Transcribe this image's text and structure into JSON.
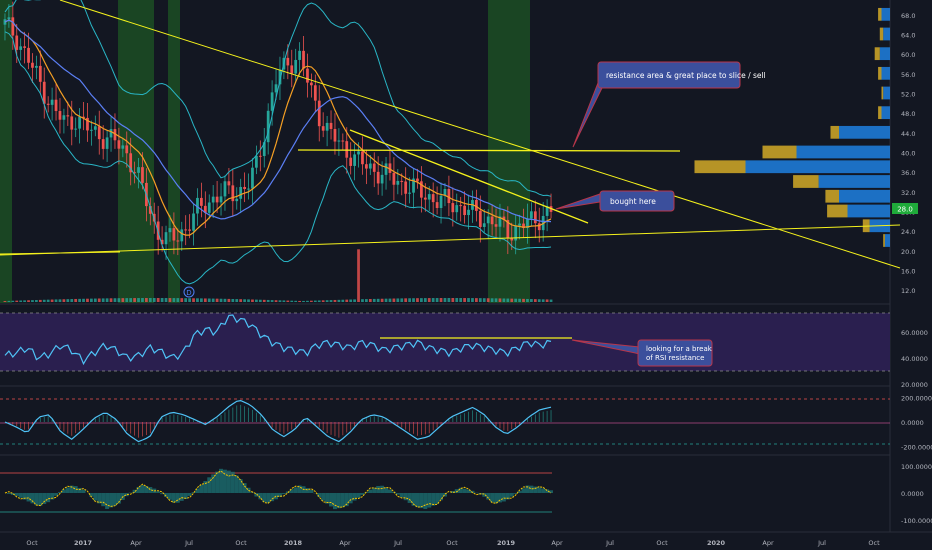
{
  "colors": {
    "background": "#131722",
    "up": "#26a69a",
    "down": "#ef5350",
    "yellow": "#f5f21c",
    "orange": "#f59f24",
    "blue_ma": "#5b7ff5",
    "bollinger": "#29b6c6",
    "rsi": "#4fc3f7",
    "rsi_band": "#2a1f4f",
    "green_zone": "#1e5a24",
    "callout_fill": "#3b4f9c",
    "callout_border": "#b8364a",
    "vp_blue": "#1e7ad6",
    "vp_gold": "#c9a227",
    "price_tag": "#1faa3a"
  },
  "chart_data": [
    {
      "type": "candlestick",
      "name": "price-panel",
      "ylim": [
        10,
        70
      ],
      "yticks": [
        "68.0",
        "64.0",
        "60.0",
        "56.0",
        "52.0",
        "48.0",
        "44.0",
        "40.0",
        "36.0",
        "32.0",
        "28.0",
        "24.0",
        "20.0",
        "16.0",
        "12.0"
      ],
      "last_price_label": "28.0",
      "close_series": [
        66,
        64,
        60,
        56,
        52,
        48,
        46,
        47,
        45,
        44,
        43,
        42,
        40,
        36,
        30,
        24,
        22,
        23,
        25,
        28,
        30,
        31,
        32,
        32,
        33,
        38,
        48,
        56,
        58,
        60,
        54,
        48,
        44,
        42,
        40,
        38,
        37,
        36,
        35,
        34,
        33,
        32,
        31,
        30,
        30,
        29,
        28,
        27,
        26,
        25,
        24,
        25,
        26,
        27,
        28
      ],
      "annotations": [
        "resistance area & great place to slice / sell",
        "bought here"
      ],
      "marker": "D"
    },
    {
      "type": "line",
      "name": "rsi-panel",
      "yticks": [
        "60.0000",
        "40.0000",
        "20.0000"
      ],
      "ylim": [
        20,
        80
      ],
      "values": [
        42,
        44,
        48,
        40,
        43,
        50,
        46,
        38,
        44,
        50,
        46,
        40,
        42,
        48,
        45,
        40,
        44,
        58,
        62,
        60,
        72,
        70,
        66,
        58,
        52,
        48,
        46,
        44,
        50,
        52,
        50,
        48,
        52,
        50,
        46,
        48,
        50,
        52,
        48,
        46,
        44,
        48,
        50,
        48,
        46,
        44,
        48,
        52,
        50,
        52
      ],
      "annotation": "looking for a break\nof RSI resistance"
    },
    {
      "type": "line",
      "name": "cci-panel",
      "yticks": [
        "200.0000",
        "0.0000",
        "-200.0000"
      ],
      "ylim": [
        -260,
        260
      ],
      "values": [
        0,
        -40,
        -90,
        40,
        60,
        -80,
        -140,
        -60,
        30,
        80,
        20,
        -100,
        -160,
        -120,
        40,
        80,
        60,
        20,
        -20,
        40,
        120,
        180,
        140,
        60,
        -60,
        -120,
        -60,
        40,
        -40,
        -120,
        -160,
        -80,
        20,
        60,
        40,
        -20,
        -80,
        -140,
        -120,
        -40,
        40,
        80,
        120,
        60,
        -40,
        -100,
        -40,
        40,
        100,
        120
      ]
    },
    {
      "type": "line",
      "name": "osc-panel",
      "yticks": [
        "100.0000",
        "0.0000",
        "-100.0000"
      ],
      "ylim": [
        -130,
        130
      ],
      "values": [
        0,
        -10,
        -30,
        -50,
        -30,
        10,
        30,
        10,
        -30,
        -60,
        -40,
        0,
        30,
        20,
        -10,
        -40,
        -20,
        20,
        60,
        90,
        80,
        40,
        -10,
        -40,
        -20,
        10,
        30,
        10,
        -30,
        -60,
        -50,
        -20,
        10,
        30,
        10,
        -20,
        -50,
        -60,
        -40,
        0,
        20,
        10,
        -10,
        -40,
        -30,
        0,
        30,
        20,
        10
      ]
    }
  ],
  "x_axis": {
    "labels": [
      "Oct",
      "2017",
      "Apr",
      "Jul",
      "Oct",
      "2018",
      "Apr",
      "Jul",
      "Oct",
      "2019",
      "Apr",
      "Jul",
      "Oct",
      "2020",
      "Apr",
      "Jul",
      "Oct"
    ],
    "bold": [
      "2017",
      "2018",
      "2019",
      "2020"
    ]
  }
}
